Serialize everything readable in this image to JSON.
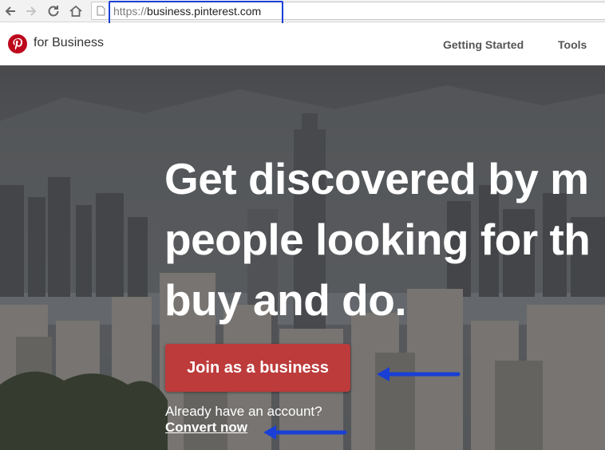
{
  "browser": {
    "url_scheme": "https://",
    "url_host": "business.pinterest.com"
  },
  "header": {
    "brand": "for Business",
    "nav": [
      "Getting Started",
      "Tools"
    ]
  },
  "hero": {
    "headline": "Get discovered by m\npeople looking for th\nbuy and do.",
    "cta_label": "Join as a business",
    "account_prompt": "Already have an account?",
    "convert_label": "Convert now"
  },
  "colors": {
    "cta": "#bd3b3b",
    "annotation": "#1a3fd6",
    "pinterest_red": "#bd081c"
  }
}
